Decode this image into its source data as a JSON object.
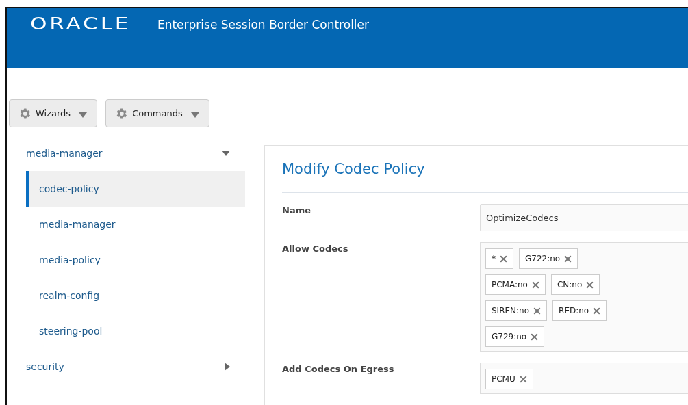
{
  "header": {
    "logo": "ORACLE",
    "title": "Enterprise Session Border Controller"
  },
  "toolbar": [
    {
      "label": "Wizards"
    },
    {
      "label": "Commands"
    }
  ],
  "sidebar": {
    "groups": [
      {
        "label": "media-manager",
        "expanded": true,
        "children": [
          {
            "label": "codec-policy",
            "selected": true
          },
          {
            "label": "media-manager",
            "selected": false
          },
          {
            "label": "media-policy",
            "selected": false
          },
          {
            "label": "realm-config",
            "selected": false
          },
          {
            "label": "steering-pool",
            "selected": false
          }
        ]
      },
      {
        "label": "security",
        "expanded": false
      }
    ]
  },
  "form": {
    "title": "Modify Codec Policy",
    "fields": [
      {
        "label": "Name",
        "kind": "text",
        "value": "OptimizeCodecs"
      },
      {
        "label": "Allow Codecs",
        "kind": "tags",
        "tags": [
          "*",
          "G722:no",
          "PCMA:no",
          "CN:no",
          "SIREN:no",
          "RED:no",
          "G729:no"
        ]
      },
      {
        "label": "Add Codecs On Egress",
        "kind": "tags",
        "tags": [
          "PCMU"
        ]
      }
    ]
  }
}
